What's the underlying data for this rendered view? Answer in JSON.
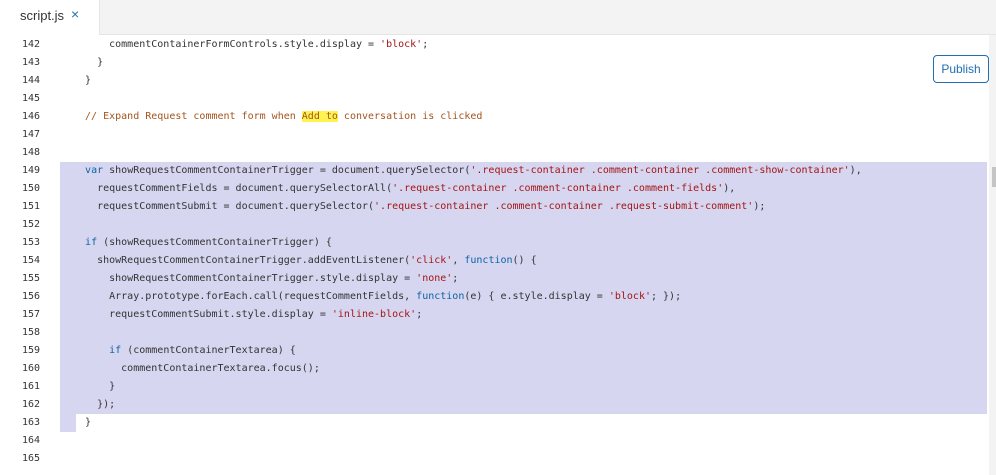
{
  "tab": {
    "title": "script.js",
    "close": "×"
  },
  "publish_label": "Publish",
  "lines": [
    {
      "n": "142",
      "text": "      commentContainerFormControls.style.display = 'block';"
    },
    {
      "n": "143",
      "text": "    }"
    },
    {
      "n": "144",
      "text": "  }"
    },
    {
      "n": "145",
      "text": ""
    },
    {
      "n": "146",
      "text": "  // Expand Request comment form when Add to conversation is clicked"
    },
    {
      "n": "147",
      "text": ""
    },
    {
      "n": "148",
      "text": ""
    },
    {
      "n": "149",
      "text": "  var showRequestCommentContainerTrigger = document.querySelector('.request-container .comment-container .comment-show-container'),"
    },
    {
      "n": "150",
      "text": "    requestCommentFields = document.querySelectorAll('.request-container .comment-container .comment-fields'),"
    },
    {
      "n": "151",
      "text": "    requestCommentSubmit = document.querySelector('.request-container .comment-container .request-submit-comment');"
    },
    {
      "n": "152",
      "text": ""
    },
    {
      "n": "153",
      "text": "  if (showRequestCommentContainerTrigger) {"
    },
    {
      "n": "154",
      "text": "    showRequestCommentContainerTrigger.addEventListener('click', function() {"
    },
    {
      "n": "155",
      "text": "      showRequestCommentContainerTrigger.style.display = 'none';"
    },
    {
      "n": "156",
      "text": "      Array.prototype.forEach.call(requestCommentFields, function(e) { e.style.display = 'block'; });"
    },
    {
      "n": "157",
      "text": "      requestCommentSubmit.style.display = 'inline-block';"
    },
    {
      "n": "158",
      "text": ""
    },
    {
      "n": "159",
      "text": "      if (commentContainerTextarea) {"
    },
    {
      "n": "160",
      "text": "        commentContainerTextarea.focus();"
    },
    {
      "n": "161",
      "text": "      }"
    },
    {
      "n": "162",
      "text": "    });"
    },
    {
      "n": "163",
      "text": "  }"
    },
    {
      "n": "164",
      "text": ""
    },
    {
      "n": "165",
      "text": ""
    }
  ],
  "comment_highlight": "Add to",
  "colors": {
    "selection": "#d7d6f0",
    "keyword": "#0b63a6",
    "string": "#a31515",
    "comment": "#a5541d",
    "accent": "#1f6fb2"
  }
}
